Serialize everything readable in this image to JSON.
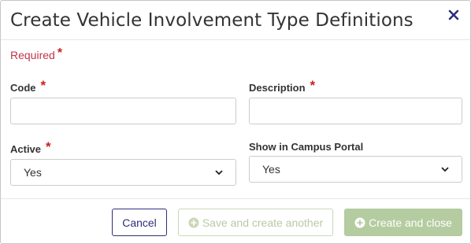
{
  "dialog": {
    "title": "Create Vehicle Involvement Type Definitions",
    "close_icon": "close-x-icon"
  },
  "form": {
    "required_note": "Required",
    "required_marker": "*",
    "code": {
      "label": "Code",
      "value": "",
      "placeholder": ""
    },
    "description": {
      "label": "Description",
      "value": "",
      "placeholder": ""
    },
    "active": {
      "label": "Active",
      "selected": "Yes"
    },
    "show_in_portal": {
      "label": "Show in Campus Portal",
      "selected": "Yes"
    }
  },
  "footer": {
    "cancel_label": "Cancel",
    "save_another_label": "Save and create another",
    "create_close_label": "Create and close"
  },
  "colors": {
    "primary": "#2d2f7a",
    "required": "#cc1f1f",
    "disabled_green": "#b4cca0"
  }
}
